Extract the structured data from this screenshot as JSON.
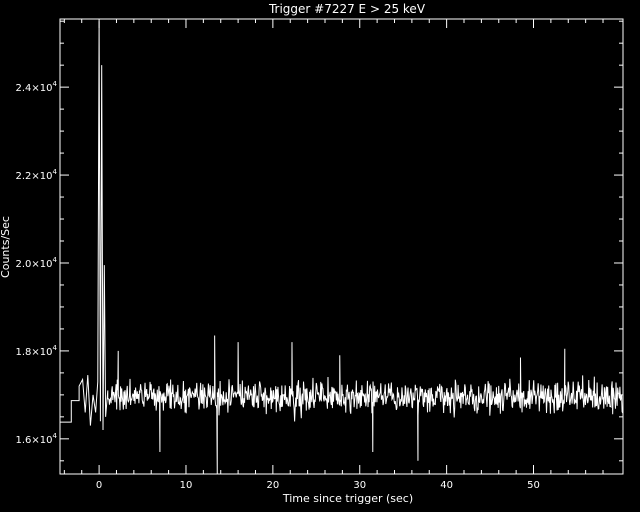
{
  "chart_data": {
    "type": "line",
    "title": "Trigger #7227 E > 25 keV",
    "xlabel": "Time since trigger (sec)",
    "ylabel": "Counts/Sec",
    "xlim": [
      -4.5,
      60.3
    ],
    "ylim": [
      15200,
      25550
    ],
    "grid": false,
    "colors": {
      "background": "#000000",
      "foreground": "#ffffff"
    },
    "x_ticks": [
      {
        "value": 0,
        "label": "0"
      },
      {
        "value": 10,
        "label": "10"
      },
      {
        "value": 20,
        "label": "20"
      },
      {
        "value": 30,
        "label": "30"
      },
      {
        "value": 40,
        "label": "40"
      },
      {
        "value": 50,
        "label": "50"
      }
    ],
    "y_ticks": [
      {
        "value": 16000,
        "label": "1.6×10",
        "exp": "4"
      },
      {
        "value": 18000,
        "label": "1.8×10",
        "exp": "4"
      },
      {
        "value": 20000,
        "label": "2.0×10",
        "exp": "4"
      },
      {
        "value": 22000,
        "label": "2.2×10",
        "exp": "4"
      },
      {
        "value": 24000,
        "label": "2.4×10",
        "exp": "4"
      }
    ],
    "series": [
      {
        "x_start": -4.5,
        "x_end": 60.3,
        "segments": [
          [
            -4.5,
            16380
          ],
          [
            -3.2,
            16380
          ],
          [
            -3.2,
            16870
          ],
          [
            -2.3,
            16870
          ],
          [
            -2.3,
            17200
          ],
          [
            -1.9,
            17350
          ],
          [
            -1.6,
            16600
          ],
          [
            -1.3,
            17450
          ],
          [
            -1.0,
            16300
          ],
          [
            -0.7,
            17000
          ],
          [
            -0.4,
            16600
          ],
          [
            -0.15,
            17300
          ],
          [
            0.0,
            25500
          ],
          [
            0.15,
            16400
          ],
          [
            0.3,
            24500
          ],
          [
            0.45,
            16200
          ],
          [
            0.6,
            19950
          ],
          [
            0.75,
            16500
          ],
          [
            1.0,
            17100
          ]
        ],
        "noise": {
          "x_from": 1.0,
          "x_to": 60.3,
          "step": 0.064,
          "mean": 16950,
          "sigma": 300,
          "spikes": [
            [
              13.3,
              18350
            ],
            [
              13.6,
              15150
            ],
            [
              16.0,
              18200
            ],
            [
              22.2,
              18200
            ],
            [
              36.7,
              15500
            ],
            [
              53.6,
              18050
            ],
            [
              2.2,
              18000
            ],
            [
              48.5,
              17850
            ],
            [
              27.7,
              17900
            ],
            [
              31.5,
              15700
            ],
            [
              7.0,
              15700
            ]
          ]
        }
      }
    ]
  }
}
